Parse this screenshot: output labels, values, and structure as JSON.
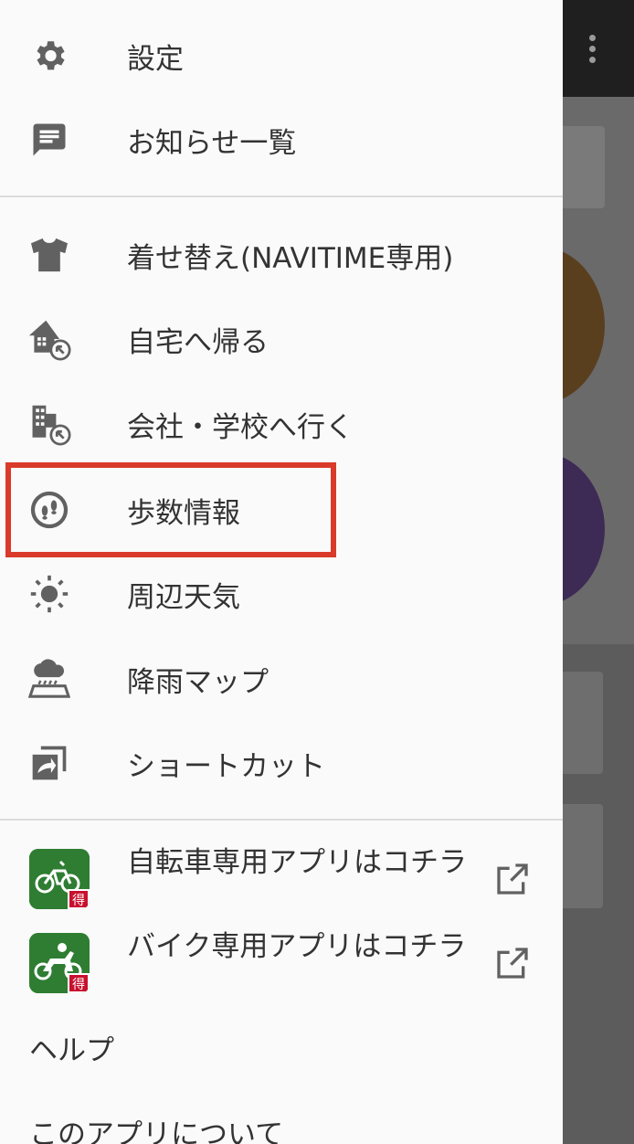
{
  "menu": {
    "settings": "設定",
    "notices": "お知らせ一覧",
    "theme": "着せ替え(NAVITIME専用)",
    "go_home": "自宅へ帰る",
    "go_work": "会社・学校へ行く",
    "steps": "歩数情報",
    "weather": "周辺天気",
    "rain_map": "降雨マップ",
    "shortcut": "ショートカット"
  },
  "external": {
    "bicycle_app": "自転車専用アプリはコチラ",
    "bike_app": "バイク専用アプリはコチラ",
    "badge": "得"
  },
  "footer": {
    "help": "ヘルプ",
    "about": "このアプリについて"
  },
  "colors": {
    "highlight": "#d93a2a",
    "app_green": "#2f7a2a",
    "badge_red": "#c8102e"
  }
}
